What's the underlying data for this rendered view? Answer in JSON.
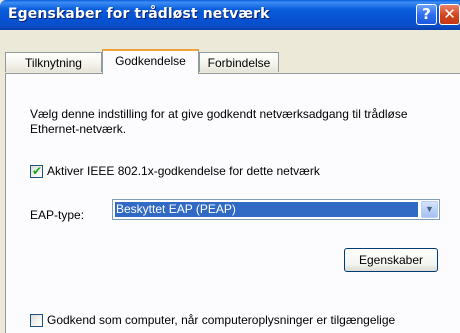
{
  "window": {
    "title": "Egenskaber for trådløst netværk",
    "help_label": "?",
    "close_label": "✕"
  },
  "tabs": [
    {
      "label": "Tilknytning",
      "active": false
    },
    {
      "label": "Godkendelse",
      "active": true
    },
    {
      "label": "Forbindelse",
      "active": false
    }
  ],
  "panel": {
    "description": "Vælg denne indstilling for at give godkendt netværksadgang til trådløse Ethernet-netværk.",
    "checkbox_8021x": {
      "label": "Aktiver IEEE 802.1x-godkendelse for dette netværk",
      "checked": true
    },
    "eap_type": {
      "label": "EAP-type:",
      "selected": "Beskyttet EAP (PEAP)"
    },
    "properties_button": "Egenskaber",
    "checkbox_computer": {
      "label": "Godkend som computer, når computeroplysninger er tilgængelige",
      "checked": false
    }
  },
  "colors": {
    "titlebar": "#0a5fdc",
    "selection": "#316ac5",
    "check": "#21a121",
    "tab_highlight": "#f2a33a"
  },
  "icons": {
    "help": "help-icon",
    "close": "close-icon",
    "dropdown": "chevron-down-icon",
    "check": "checkmark-icon"
  }
}
